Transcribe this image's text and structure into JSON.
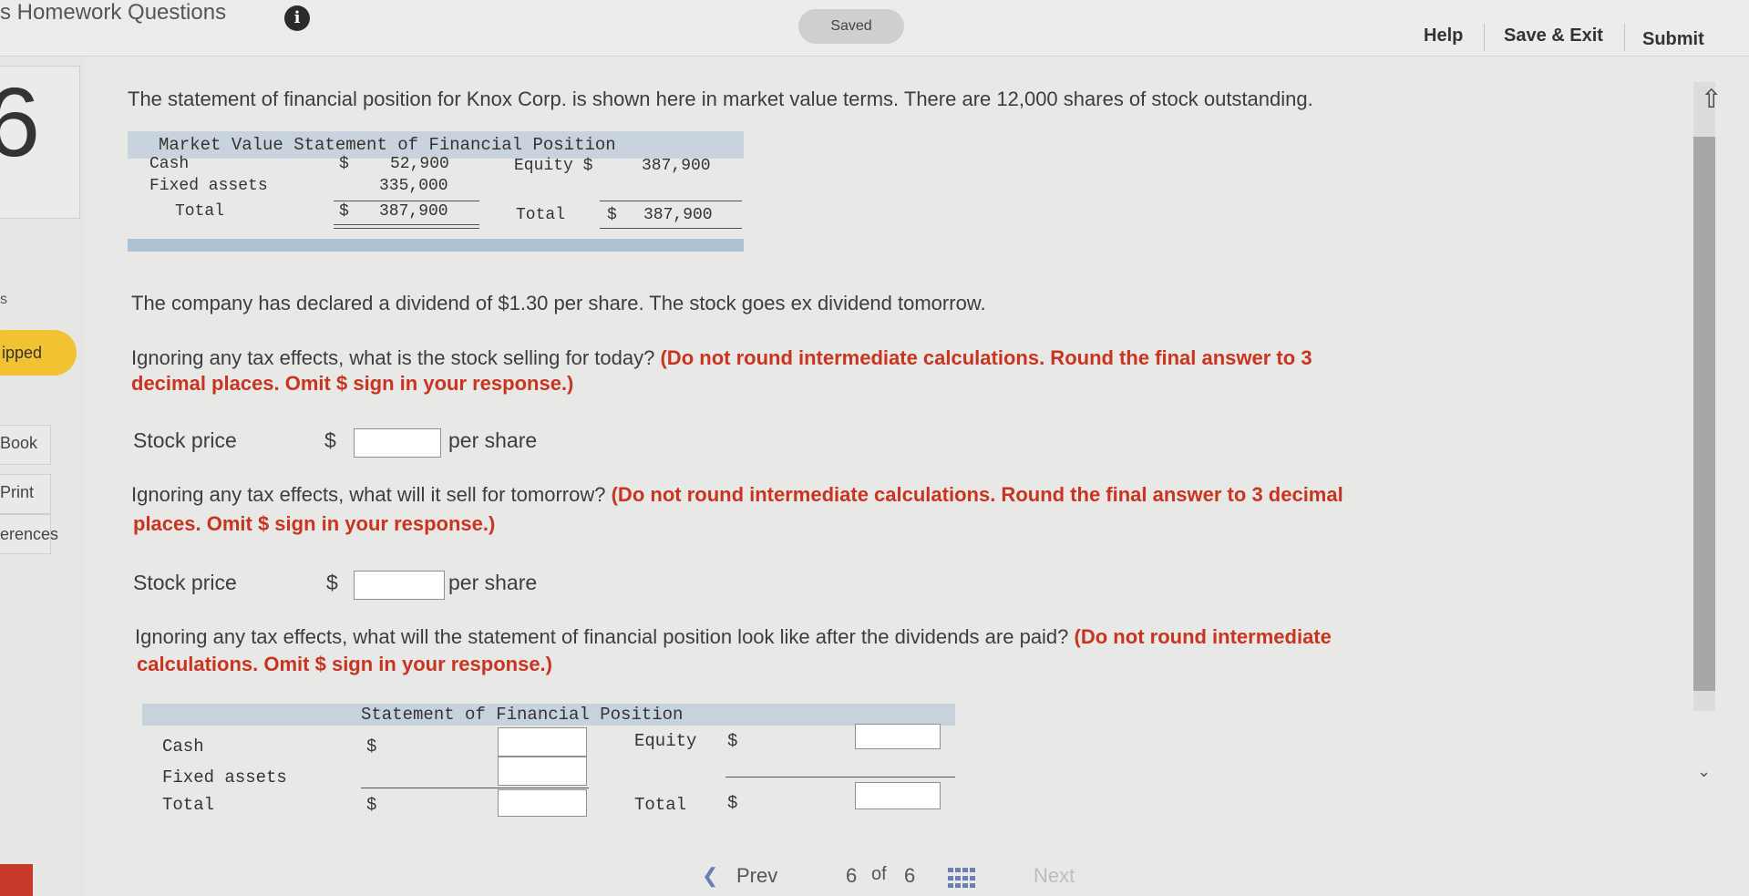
{
  "header": {
    "assignment_title": "s Homework Questions",
    "saved_label": "Saved",
    "help_label": "Help",
    "save_exit_label": "Save & Exit",
    "submit_label": "Submit"
  },
  "sidebar": {
    "question_number": "6",
    "partial_letter": "s",
    "status_label": "ipped",
    "book_label": "Book",
    "print_label": "Print",
    "references_label": "erences"
  },
  "question": {
    "intro": "The statement of financial position for Knox Corp. is shown here in market value terms. There are 12,000 shares of stock outstanding.",
    "table1": {
      "title": "Market Value Statement of Financial Position",
      "cash_label": "Cash",
      "cash_dollar": "$",
      "cash_value": "52,900",
      "fixed_label": "Fixed assets",
      "fixed_value": "335,000",
      "total_label": "Total",
      "total_dollar": "$",
      "total_value": "387,900",
      "equity_label": "Equity $",
      "equity_value": "387,900",
      "total2_label": "Total",
      "total2_dollar": "$",
      "total2_value": "387,900"
    },
    "dividend_text": "The company has declared a dividend of $1.30 per share. The stock goes ex dividend tomorrow.",
    "part1": {
      "text": "Ignoring any tax effects, what is the stock selling for today?",
      "instruction_line1": "(Do not round intermediate calculations. Round the final answer to 3",
      "instruction_line2": "decimal places. Omit $ sign in your response.)",
      "label": "Stock price",
      "dollar": "$",
      "unit": "per share",
      "value": ""
    },
    "part2": {
      "text": "Ignoring any tax effects, what will it sell for tomorrow?",
      "instruction_line1": "(Do not round intermediate calculations. Round the final answer to 3 decimal",
      "instruction_line2": "places. Omit $ sign in your response.)",
      "label": "Stock price",
      "dollar": "$",
      "unit": "per share",
      "value": ""
    },
    "part3": {
      "text": "Ignoring any tax effects, what will the statement of financial position look like after the dividends are paid?",
      "instruction_line1": "(Do not round intermediate",
      "instruction_line2": "calculations. Omit $ sign in your response.)"
    },
    "table2": {
      "title": "Statement of Financial Position",
      "cash_label": "Cash",
      "cash_dollar": "$",
      "fixed_label": "Fixed assets",
      "total_label": "Total",
      "total_dollar": "$",
      "equity_label": "Equity",
      "equity_dollar": "$",
      "total2_label": "Total",
      "total2_dollar": "$"
    }
  },
  "navigation": {
    "prev_label": "Prev",
    "page_current": "6",
    "page_of": "of",
    "page_total": "6",
    "next_label": "Next"
  }
}
